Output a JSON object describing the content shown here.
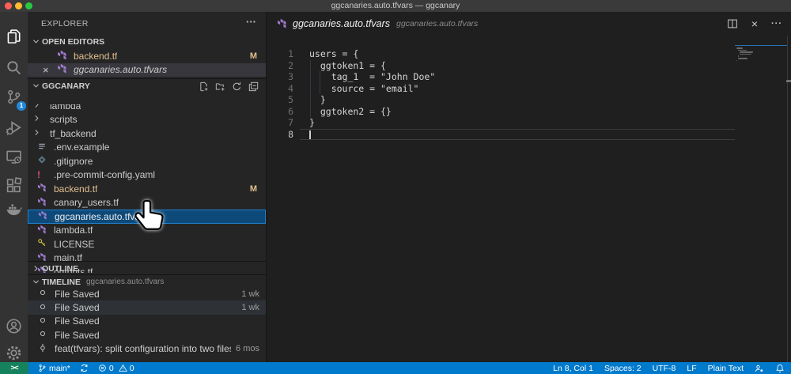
{
  "window": {
    "title": "ggcanaries.auto.tfvars — ggcanary"
  },
  "activity_bar": {
    "items": [
      {
        "name": "explorer",
        "icon": "files-icon",
        "active": true
      },
      {
        "name": "search",
        "icon": "search-icon"
      },
      {
        "name": "source-control",
        "icon": "source-control-icon",
        "badge": "1"
      },
      {
        "name": "run-debug",
        "icon": "debug-icon"
      },
      {
        "name": "remote-explorer",
        "icon": "remote-explorer-icon"
      },
      {
        "name": "extensions",
        "icon": "extensions-icon"
      },
      {
        "name": "docker",
        "icon": "docker-icon"
      }
    ],
    "bottom_items": [
      {
        "name": "accounts",
        "icon": "account-icon"
      },
      {
        "name": "settings",
        "icon": "gear-icon"
      }
    ]
  },
  "sidebar": {
    "title": "EXPLORER",
    "more_label": "···",
    "open_editors": {
      "header": "OPEN EDITORS",
      "items": [
        {
          "label": "backend.tf",
          "icon": "terraform-icon",
          "badge": "M",
          "modified": true
        },
        {
          "label": "ggcanaries.auto.tfvars",
          "icon": "terraform-icon",
          "active": true,
          "preview": true,
          "closable": true
        }
      ]
    },
    "tree": {
      "header": "GGCANARY",
      "actions": [
        "new-file-icon",
        "new-folder-icon",
        "refresh-icon",
        "collapse-all-icon"
      ],
      "items": [
        {
          "kind": "folder",
          "label": "lambda"
        },
        {
          "kind": "folder",
          "label": "scripts"
        },
        {
          "kind": "folder",
          "label": "tf_backend"
        },
        {
          "kind": "file",
          "label": ".env.example",
          "icon": "env-icon"
        },
        {
          "kind": "file",
          "label": ".gitignore",
          "icon": "gitignore-icon"
        },
        {
          "kind": "file",
          "label": ".pre-commit-config.yaml",
          "icon": "yaml-icon"
        },
        {
          "kind": "file",
          "label": "backend.tf",
          "icon": "terraform-icon",
          "badge": "M",
          "modified": true
        },
        {
          "kind": "file",
          "label": "canary_users.tf",
          "icon": "terraform-icon"
        },
        {
          "kind": "file",
          "label": "ggcanaries.auto.tfvars",
          "icon": "terraform-icon",
          "selected": true
        },
        {
          "kind": "file",
          "label": "lambda.tf",
          "icon": "terraform-icon"
        },
        {
          "kind": "file",
          "label": "LICENSE",
          "icon": "license-icon"
        },
        {
          "kind": "file",
          "label": "main.tf",
          "icon": "terraform-icon"
        },
        {
          "kind": "file",
          "label": "outputs.tf",
          "icon": "terraform-icon"
        }
      ]
    },
    "outline": {
      "header": "OUTLINE",
      "collapsed": true
    },
    "timeline": {
      "header": "TIMELINE",
      "description": "ggcanaries.auto.tfvars",
      "items": [
        {
          "icon": "history-circle-icon",
          "label": "File Saved",
          "time": "1 wk"
        },
        {
          "icon": "history-circle-icon",
          "label": "File Saved",
          "time": "1 wk",
          "hover": true
        },
        {
          "icon": "history-circle-icon",
          "label": "File Saved",
          "time": ""
        },
        {
          "icon": "history-circle-icon",
          "label": "File Saved",
          "time": ""
        },
        {
          "icon": "git-commit-icon",
          "label": "feat(tfvars): split configuration into two files ......",
          "time": "6 mos"
        }
      ]
    }
  },
  "editor": {
    "tab": {
      "icon": "terraform-icon",
      "label": "ggcanaries.auto.tfvars",
      "description": "ggcanaries.auto.tfvars"
    },
    "actions": [
      {
        "name": "split-editor",
        "icon": "split-editor-icon"
      },
      {
        "name": "close-editor",
        "icon": "close-icon"
      },
      {
        "name": "more-actions",
        "icon": "more-icon"
      }
    ],
    "code_lines": [
      "users = {",
      "  ggtoken1 = {",
      "    tag_1  = \"John Doe\"",
      "    source = \"email\"",
      "  }",
      "  ggtoken2 = {}",
      "}",
      ""
    ],
    "cursor": {
      "line": 8,
      "col": 1
    }
  },
  "status_bar": {
    "colors": {
      "background": "#007acc",
      "remote_background": "#16825d"
    },
    "remote_icon": "remote-icon",
    "remote_glyph": "><",
    "left": [
      {
        "name": "git-branch",
        "icon": "branch-icon",
        "label": "main*"
      },
      {
        "name": "sync",
        "icon": "sync-icon",
        "label": ""
      },
      {
        "name": "errors",
        "icon": "error-icon",
        "label": "0"
      },
      {
        "name": "warnings",
        "icon": "warning-icon",
        "label": "0"
      }
    ],
    "right": [
      {
        "name": "cursor-position",
        "label": "Ln 8, Col 1"
      },
      {
        "name": "indentation",
        "label": "Spaces: 2"
      },
      {
        "name": "encoding",
        "label": "UTF-8"
      },
      {
        "name": "eol",
        "label": "LF"
      },
      {
        "name": "language-mode",
        "label": "Plain Text"
      },
      {
        "name": "feedback",
        "icon": "feedback-icon",
        "label": ""
      },
      {
        "name": "notifications",
        "icon": "bell-icon",
        "label": ""
      }
    ]
  }
}
